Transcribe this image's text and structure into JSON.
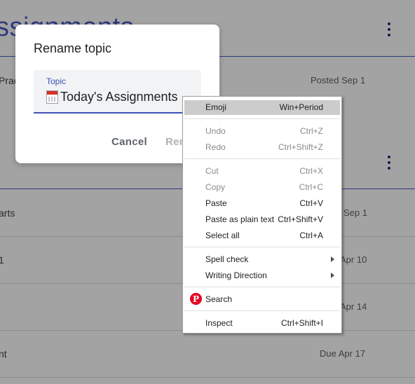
{
  "background": {
    "title": "ssignments",
    "rows": [
      {
        "label": "Prac",
        "date": "Posted Sep 1"
      },
      {
        "label": "arts",
        "date": "Sep 1"
      },
      {
        "label": "1",
        "date": "Apr 10"
      },
      {
        "label": "",
        "date": "Apr 14"
      },
      {
        "label": "nt",
        "date": "Due Apr 17"
      }
    ]
  },
  "dialog": {
    "title": "Rename topic",
    "field_label": "Topic",
    "field_value": "Today's Assignments",
    "cancel_label": "Cancel",
    "rename_label": "Rename"
  },
  "context_menu": {
    "items": [
      {
        "label": "Emoji",
        "shortcut": "Win+Period"
      },
      {
        "label": "Undo",
        "shortcut": "Ctrl+Z"
      },
      {
        "label": "Redo",
        "shortcut": "Ctrl+Shift+Z"
      },
      {
        "label": "Cut",
        "shortcut": "Ctrl+X"
      },
      {
        "label": "Copy",
        "shortcut": "Ctrl+C"
      },
      {
        "label": "Paste",
        "shortcut": "Ctrl+V"
      },
      {
        "label": "Paste as plain text",
        "shortcut": "Ctrl+Shift+V"
      },
      {
        "label": "Select all",
        "shortcut": "Ctrl+A"
      },
      {
        "label": "Spell check",
        "shortcut": ""
      },
      {
        "label": "Writing Direction",
        "shortcut": ""
      },
      {
        "label": "Search",
        "shortcut": "",
        "icon": "pinterest-icon"
      },
      {
        "label": "Inspect",
        "shortcut": "Ctrl+Shift+I"
      }
    ]
  },
  "colors": {
    "accent": "#3f51b5",
    "pinterest": "#e60023"
  }
}
